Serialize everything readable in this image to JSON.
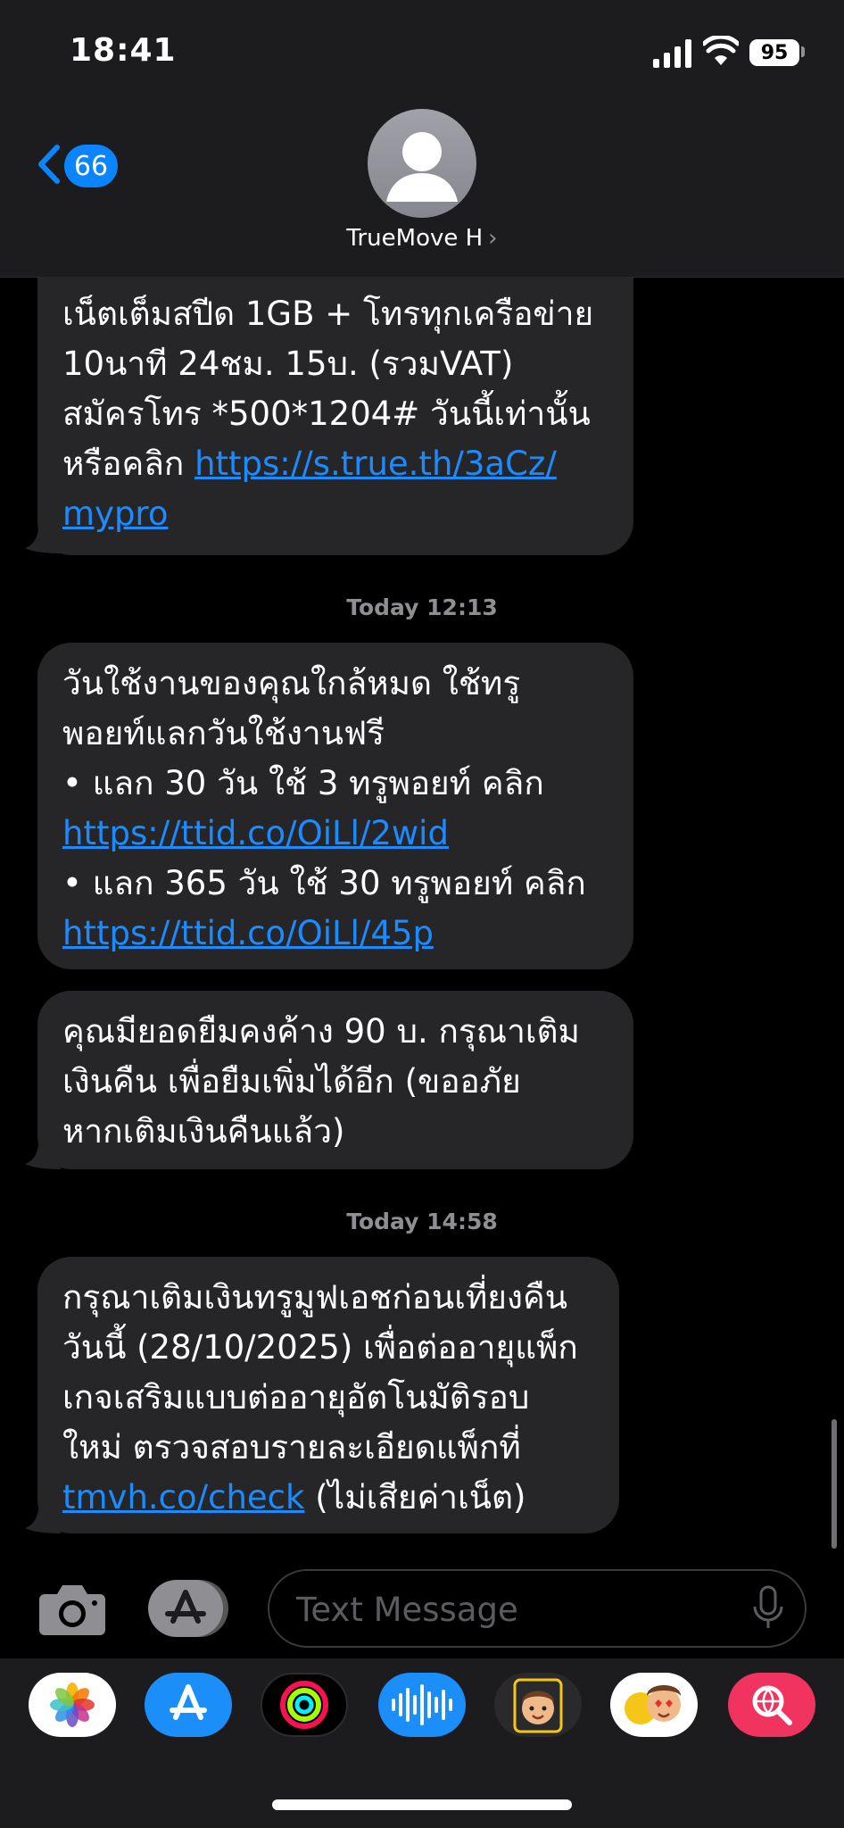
{
  "status_bar": {
    "time": "18:41",
    "battery": "95"
  },
  "header": {
    "back_count": "66",
    "contact_name": "TrueMove H",
    "contact_chevron": "›"
  },
  "messages": [
    {
      "lines": [
        "เน็ตเต็มสปีด 1GB + โทรทุกเครือข่าย",
        "10นาที 24ชม. 15บ. (รวมVAT)",
        "สมัครโทร *500*1204# วันนี้เท่านั้น"
      ],
      "line4_text": "หรือคลิก ",
      "link_part1": "https://s.true.th/3aCz/",
      "link_part2": "mypro"
    },
    {
      "lines": [
        "วันใช้งานของคุณใกล้หมด ใช้ทรู",
        "พอยท์แลกวันใช้งานฟรี",
        "• แลก 30 วัน ใช้ 3 ทรูพอยท์ คลิก"
      ],
      "link1": "https://ttid.co/OiLl/2wid",
      "line5": "• แลก 365 วัน ใช้ 30 ทรูพอยท์ คลิก",
      "link2": "https://ttid.co/OiLl/45p"
    },
    {
      "lines": [
        "คุณมียอดยืมคงค้าง 90 บ. กรุณาเติม",
        "เงินคืน เพื่อยืมเพิ่มได้อีก (ขออภัย",
        "หากเติมเงินคืนแล้ว)"
      ]
    },
    {
      "lines": [
        "กรุณาเติมเงินทรูมูฟเอชก่อนเที่ยงคืน",
        "วันนี้ (28/10/2025) เพื่อต่ออายุแพ็ก",
        "เกจเสริมแบบต่ออายุอัตโนมัติรอบ",
        "ใหม่ ตรวจสอบรายละเอียดแพ็กที่"
      ],
      "link": "tmvh.co/check",
      "link_suffix": " (ไม่เสียค่าเน็ต)"
    }
  ],
  "timestamps": [
    "Today 12:13",
    "Today 14:58"
  ],
  "composer": {
    "placeholder": "Text Message"
  },
  "dock": [
    "photos-app",
    "app-store",
    "fitness-activity",
    "audio-message",
    "memoji",
    "animoji-stickers",
    "image-search"
  ],
  "colors": {
    "bubble": "#262629",
    "link": "#1a8cff",
    "accent": "#0a84ff"
  }
}
